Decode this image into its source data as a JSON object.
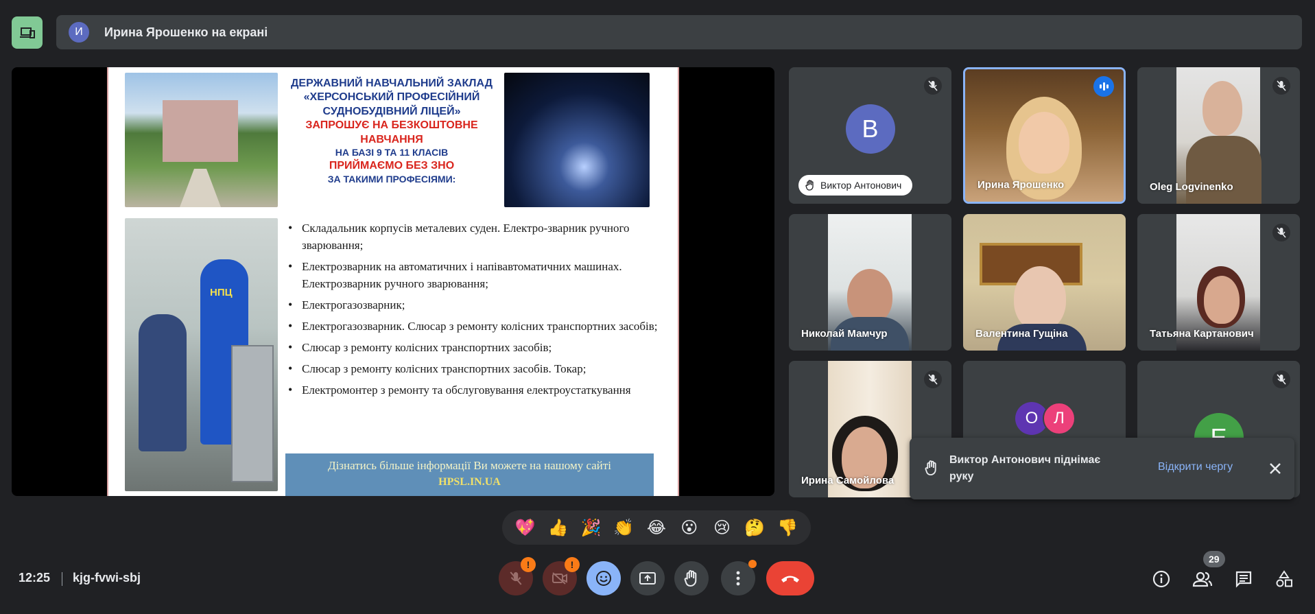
{
  "header": {
    "presenter_initial": "И",
    "presenter_title": "Ирина Ярошенко на екрані"
  },
  "slide": {
    "heading_line1": "ДЕРЖАВНИЙ НАВЧАЛЬНИЙ ЗАКЛАД",
    "heading_line2": "«ХЕРСОНСЬКИЙ ПРОФЕСІЙНИЙ",
    "heading_line3": "СУДНОБУДІВНИЙ ЛІЦЕЙ»",
    "invite_line": "ЗАПРОШУЄ НА БЕЗКОШТОВНЕ НАВЧАННЯ",
    "base_line": "НА БАЗІ 9 ТА 11 КЛАСІВ",
    "no_zno_line": "ПРИЙМАЄМО БЕЗ ЗНО",
    "professions_line": "ЗА ТАКИМИ ПРОФЕСІЯМИ:",
    "items": [
      "Складальник корпусів металевих суден. Електро-зварник ручного зварювання;",
      "Електрозварник на автоматичних і напівавтоматичних машинах. Електрозварник ручного зварювання;",
      "Електрогазозварник;",
      "Електрогазозварник. Слюсар з ремонту колісних транспортних засобів;",
      "Слюсар з ремонту колісних транспортних засобів;",
      "Слюсар з ремонту колісних транспортних засобів. Токар;",
      "Електромонтер з ремонту та обслуговування електроустаткування"
    ],
    "footer_line1": "Дізнатись більше інформації Ви можете на нашому сайті",
    "footer_line2": "HPSL.IN.UA",
    "badge_text": "НПЦ"
  },
  "participants": {
    "viktor": {
      "initial": "В",
      "name": "Виктор Антонович",
      "color": "#5c6bc0"
    },
    "iryna_y": {
      "name": "Ирина Ярошенко"
    },
    "oleg": {
      "name": "Oleg Logvinenko"
    },
    "mykolai": {
      "name": "Николай Мамчур"
    },
    "valentyna": {
      "name": "Валентина Гущіна"
    },
    "tetiana": {
      "name": "Татьяна Картанович"
    },
    "iryna_s": {
      "name": "Ирина Самойлова"
    },
    "group": {
      "initial1": "О",
      "initial2": "Л",
      "color1": "#5e35b1",
      "color2": "#ec407a"
    },
    "e_user": {
      "initial": "E",
      "color": "#43a047"
    }
  },
  "toast": {
    "message": "Виктор Антонович піднімає руку",
    "action": "Відкрити чергу"
  },
  "reactions": [
    "💖",
    "👍",
    "🎉",
    "👏",
    "😂",
    "😮",
    "😢",
    "🤔",
    "👎"
  ],
  "bottom": {
    "time": "12:25",
    "meeting_code": "kjg-fvwi-sbj",
    "mic_warning": "!",
    "cam_warning": "!",
    "people_count": "29"
  },
  "colors": {
    "accent": "#8ab4f8",
    "end_call": "#ea4335",
    "warning": "#fa7b17",
    "app_green": "#81c995"
  }
}
